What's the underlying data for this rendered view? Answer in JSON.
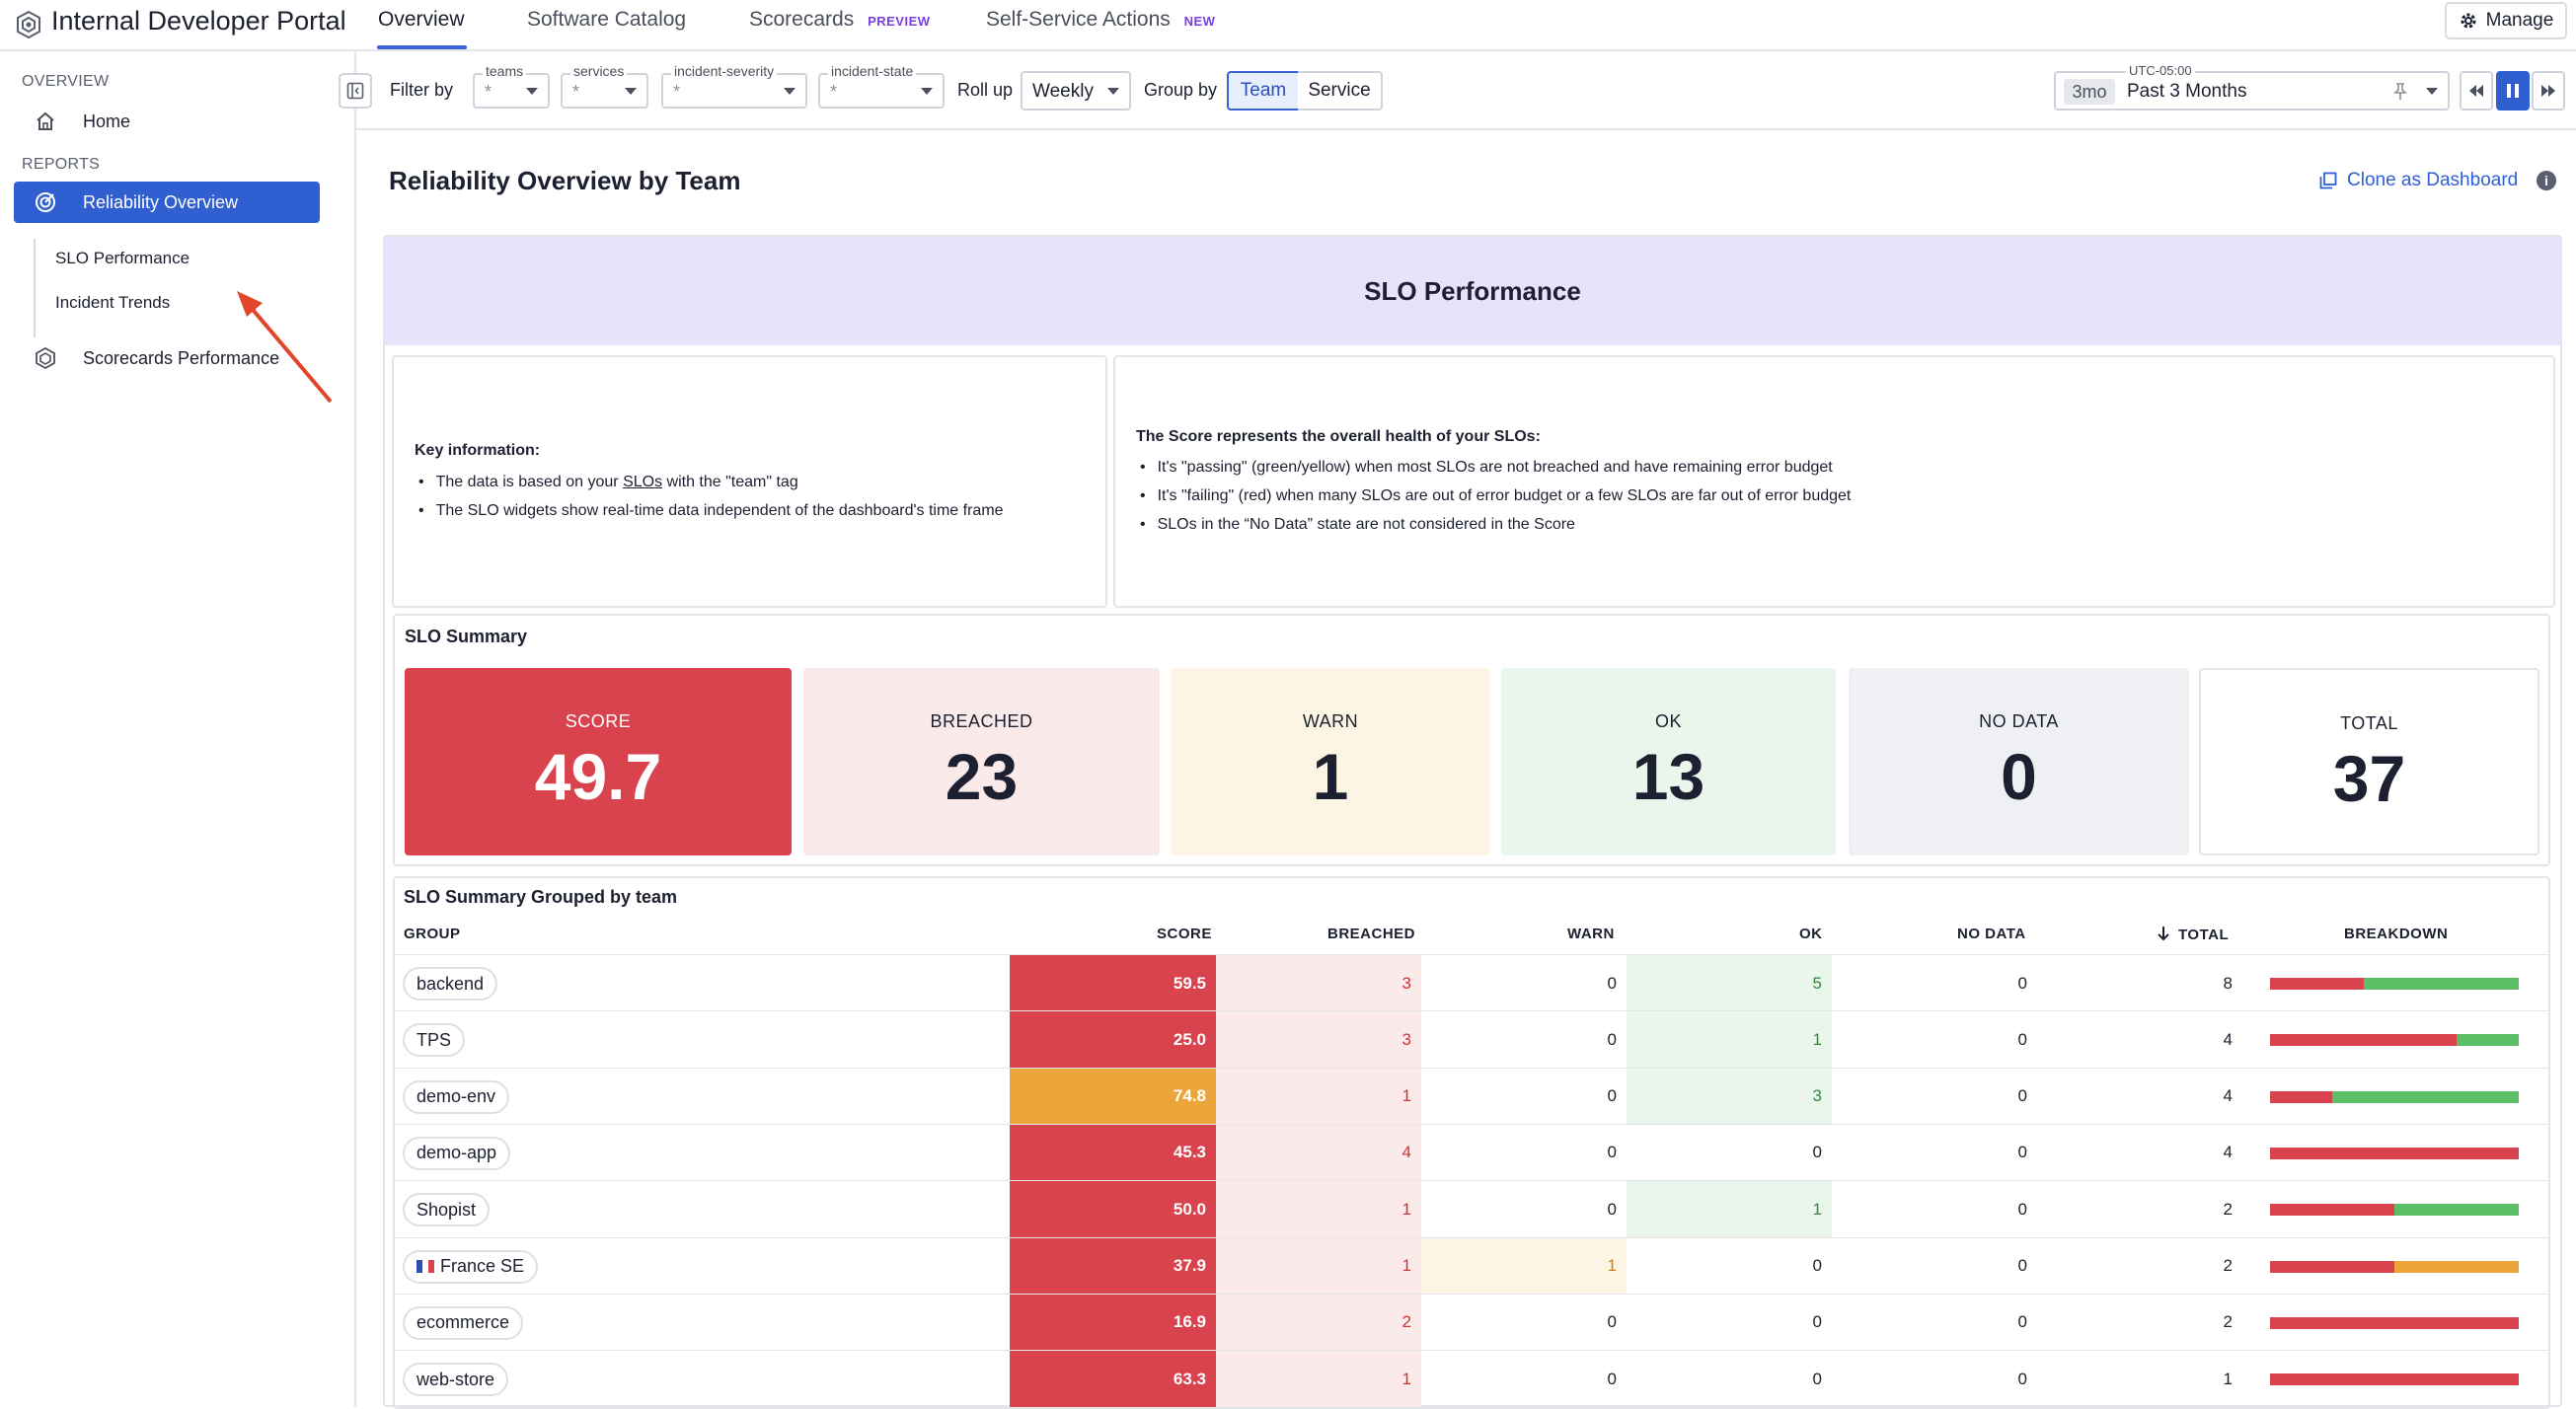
{
  "app": {
    "title": "Internal Developer Portal",
    "nav_tabs": [
      {
        "label": "Overview",
        "tag": ""
      },
      {
        "label": "Software Catalog",
        "tag": ""
      },
      {
        "label": "Scorecards",
        "tag": "PREVIEW"
      },
      {
        "label": "Self-Service Actions",
        "tag": "NEW"
      }
    ],
    "manage_label": "Manage"
  },
  "sidebar": {
    "overview_heading": "OVERVIEW",
    "home_label": "Home",
    "reports_heading": "REPORTS",
    "reliability_label": "Reliability Overview",
    "sub_items": [
      "SLO Performance",
      "Incident Trends"
    ],
    "scorecards_label": "Scorecards Performance"
  },
  "filters": {
    "filter_by_label": "Filter by",
    "selects": [
      {
        "label": "teams",
        "value": "*"
      },
      {
        "label": "services",
        "value": "*"
      },
      {
        "label": "incident-severity",
        "value": "*"
      },
      {
        "label": "incident-state",
        "value": "*"
      }
    ],
    "rollup_label": "Roll up",
    "rollup_value": "Weekly",
    "groupby_label": "Group by",
    "groupby_options": [
      "Team",
      "Service"
    ],
    "groupby_selected": "Team",
    "timezone": "UTC-05:00",
    "range_chip": "3mo",
    "range_text": "Past 3 Months"
  },
  "page": {
    "title": "Reliability Overview by Team",
    "clone_label": "Clone as Dashboard"
  },
  "slo": {
    "header": "SLO Performance",
    "key_info": {
      "title": "Key information:",
      "line1_prefix": "The data is based on your ",
      "line1_link": "SLOs",
      "line1_suffix": " with the \"team\" tag",
      "line2": "The SLO widgets show real-time data independent of the dashboard's time frame"
    },
    "score_info": {
      "title": "The Score represents the overall health of your SLOs:",
      "lines": [
        "It's \"passing\" (green/yellow) when most SLOs are not breached and have remaining error budget",
        "It's \"failing\" (red) when many SLOs are out of error budget or a few SLOs are far out of error budget",
        "SLOs in the “No Data” state are not considered in the Score"
      ]
    },
    "summary_title": "SLO Summary",
    "tiles": [
      {
        "label": "SCORE",
        "value": "49.7"
      },
      {
        "label": "BREACHED",
        "value": "23"
      },
      {
        "label": "WARN",
        "value": "1"
      },
      {
        "label": "OK",
        "value": "13"
      },
      {
        "label": "NO DATA",
        "value": "0"
      },
      {
        "label": "TOTAL",
        "value": "37"
      }
    ],
    "grouped_title": "SLO Summary Grouped by team",
    "columns": [
      "GROUP",
      "SCORE",
      "BREACHED",
      "WARN",
      "OK",
      "NO DATA",
      "TOTAL",
      "BREAKDOWN"
    ],
    "rows": [
      {
        "group": "backend",
        "flag": "",
        "score": "59.5",
        "breached": "3",
        "warn": "0",
        "ok": "5",
        "nodata": "0",
        "total": "8",
        "score_color": "#d9434d",
        "warn_hl": false,
        "ok_hl": true
      },
      {
        "group": "TPS",
        "flag": "",
        "score": "25.0",
        "breached": "3",
        "warn": "0",
        "ok": "1",
        "nodata": "0",
        "total": "4",
        "score_color": "#d9434d",
        "warn_hl": false,
        "ok_hl": true
      },
      {
        "group": "demo-env",
        "flag": "",
        "score": "74.8",
        "breached": "1",
        "warn": "0",
        "ok": "3",
        "nodata": "0",
        "total": "4",
        "score_color": "#eba53a",
        "warn_hl": false,
        "ok_hl": true
      },
      {
        "group": "demo-app",
        "flag": "",
        "score": "45.3",
        "breached": "4",
        "warn": "0",
        "ok": "0",
        "nodata": "0",
        "total": "4",
        "score_color": "#d9434d",
        "warn_hl": false,
        "ok_hl": false
      },
      {
        "group": "Shopist",
        "flag": "",
        "score": "50.0",
        "breached": "1",
        "warn": "0",
        "ok": "1",
        "nodata": "0",
        "total": "2",
        "score_color": "#d9434d",
        "warn_hl": false,
        "ok_hl": true
      },
      {
        "group": "France SE",
        "flag": "FR",
        "score": "37.9",
        "breached": "1",
        "warn": "1",
        "ok": "0",
        "nodata": "0",
        "total": "2",
        "score_color": "#d9434d",
        "warn_hl": true,
        "ok_hl": false
      },
      {
        "group": "ecommerce",
        "flag": "",
        "score": "16.9",
        "breached": "2",
        "warn": "0",
        "ok": "0",
        "nodata": "0",
        "total": "2",
        "score_color": "#d9434d",
        "warn_hl": false,
        "ok_hl": false
      },
      {
        "group": "web-store",
        "flag": "",
        "score": "63.3",
        "breached": "1",
        "warn": "0",
        "ok": "0",
        "nodata": "0",
        "total": "1",
        "score_color": "#d9434d",
        "warn_hl": false,
        "ok_hl": false
      }
    ]
  },
  "colors": {
    "accent": "#2f5fd0",
    "red": "#d9434d",
    "orange": "#eba53a",
    "green": "#5cbf66",
    "breached_bg": "#fbeaea",
    "warn_bg": "#fdf5e3",
    "ok_bg": "#eaf6ec",
    "nodata_bg": "#eef0f3"
  },
  "icons": [
    "portal-logo-icon",
    "gear-icon",
    "home-icon",
    "reliability-icon",
    "scorecards-icon",
    "collapse-panel-icon",
    "pin-icon",
    "step-back-icon",
    "pause-icon",
    "step-forward-icon",
    "clone-icon",
    "info-icon",
    "sort-down-icon",
    "annotation-arrow"
  ]
}
